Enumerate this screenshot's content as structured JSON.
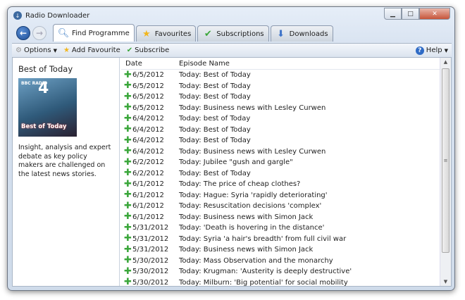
{
  "window": {
    "title": "Radio Downloader"
  },
  "tabs": [
    {
      "label": "Find Programme",
      "icon": "search-icon"
    },
    {
      "label": "Favourites",
      "icon": "star-icon"
    },
    {
      "label": "Subscriptions",
      "icon": "check-icon"
    },
    {
      "label": "Downloads",
      "icon": "down-arrow-icon"
    }
  ],
  "toolbar": {
    "options": "Options",
    "add_favourite": "Add Favourite",
    "subscribe": "Subscribe",
    "help": "Help"
  },
  "programme": {
    "title": "Best of Today",
    "art_brand": "BBC RADIO",
    "art_number": "4",
    "art_caption": "Best of Today",
    "description": "Insight, analysis and expert debate as key policy makers are challenged on the latest news stories."
  },
  "list": {
    "headers": [
      "Date",
      "Episode Name"
    ],
    "rows": [
      [
        "6/5/2012",
        "Today: Best of Today"
      ],
      [
        "6/5/2012",
        "Today: Best of Today"
      ],
      [
        "6/5/2012",
        "Today: Best of Today"
      ],
      [
        "6/5/2012",
        "Today: Business news with Lesley Curwen"
      ],
      [
        "6/4/2012",
        "Today: best of Today"
      ],
      [
        "6/4/2012",
        "Today: Best of Today"
      ],
      [
        "6/4/2012",
        "Today: Best of Today"
      ],
      [
        "6/4/2012",
        "Today: Business news with Lesley Curwen"
      ],
      [
        "6/2/2012",
        "Today: Jubilee \"gush and gargle\""
      ],
      [
        "6/2/2012",
        "Today: Best of Today"
      ],
      [
        "6/1/2012",
        "Today: The price of cheap clothes?"
      ],
      [
        "6/1/2012",
        "Today: Hague: Syria 'rapidly deteriorating'"
      ],
      [
        "6/1/2012",
        "Today: Resuscitation decisions 'complex'"
      ],
      [
        "6/1/2012",
        "Today: Business news with Simon Jack"
      ],
      [
        "5/31/2012",
        "Today: 'Death is hovering in the distance'"
      ],
      [
        "5/31/2012",
        "Today: Syria 'a hair's breadth' from full civil war"
      ],
      [
        "5/31/2012",
        "Today: Business news with Simon Jack"
      ],
      [
        "5/30/2012",
        "Today: Mass Observation and the monarchy"
      ],
      [
        "5/30/2012",
        "Today: Krugman: 'Austerity is deeply destructive'"
      ],
      [
        "5/30/2012",
        "Today: Milburn: 'Big potential' for social mobility"
      ]
    ]
  }
}
